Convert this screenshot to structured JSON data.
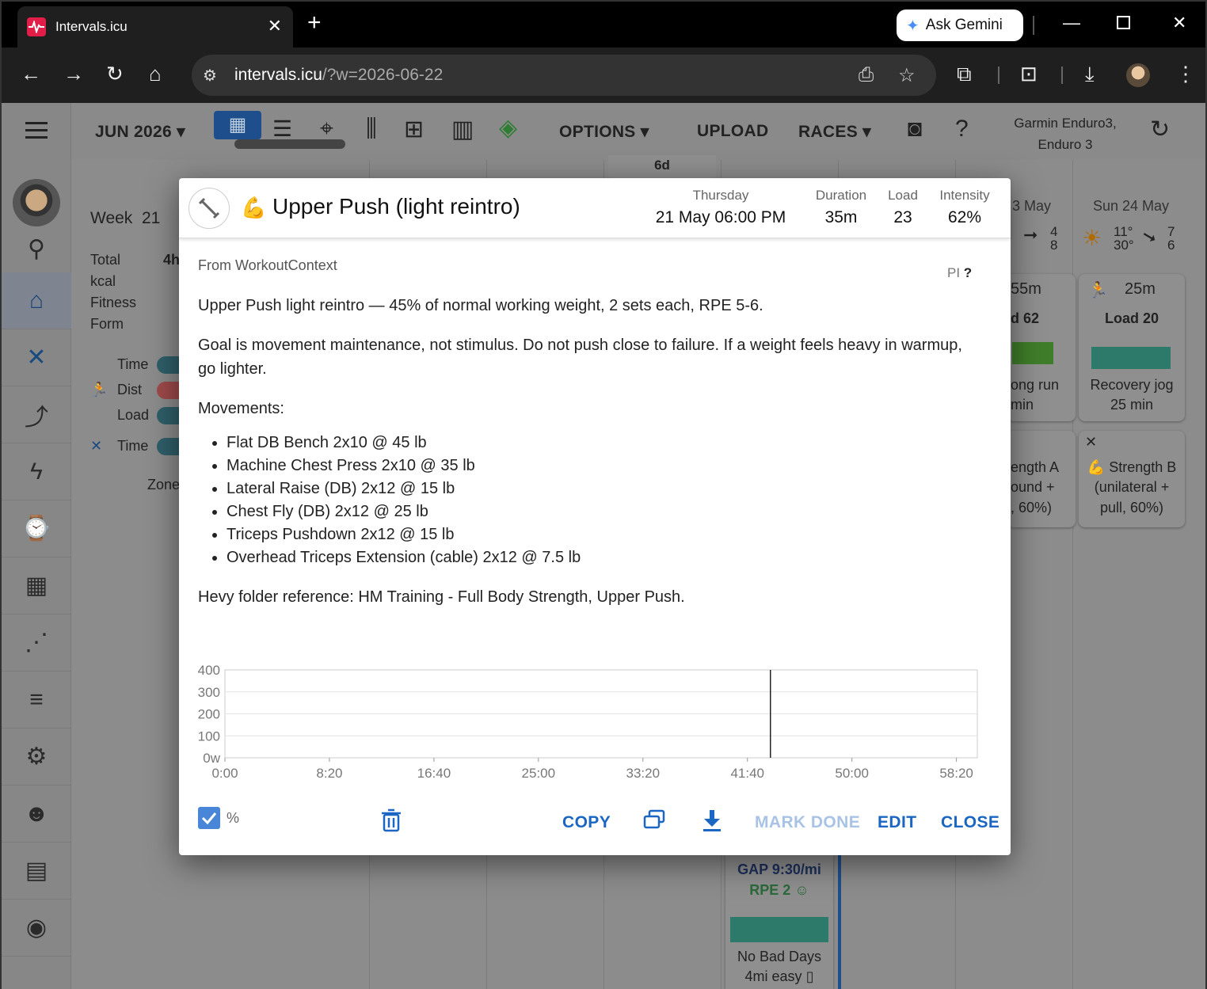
{
  "browser": {
    "tab_title": "Intervals.icu",
    "url_host": "intervals.icu",
    "url_path": "/?w=2026-06-22",
    "gemini_label": "Ask Gemini"
  },
  "topbar": {
    "month": "JUN 2026",
    "options": "OPTIONS",
    "upload": "UPLOAD",
    "races": "RACES",
    "device_line1": "Garmin Enduro3,",
    "device_line2": "Enduro 3",
    "tab_count": "6d"
  },
  "week": {
    "title": "Week",
    "number": "21",
    "total_label": "Total",
    "total_value": "4h",
    "kcal_label": "kcal",
    "fitness_label": "Fitness",
    "form_label": "Form",
    "time_label": "Time",
    "dist_label": "Dist",
    "load_label": "Load",
    "time2_label": "Time",
    "zones_label": "Zone"
  },
  "calendar": {
    "sat_head": "3 May",
    "sun_head": "Sun 24 May",
    "sat_weather_a": "4",
    "sat_weather_b": "8",
    "sun_temp_hi": "11°",
    "sun_temp_lo": "30°",
    "sun_wind_a": "7",
    "sun_wind_b": "6",
    "sat_card_duration": "55m",
    "sat_card_load": "d 62",
    "sat_card_name1": "ong run",
    "sat_card_name2": "min",
    "sun_card_duration": "25m",
    "sun_card_load": "Load 20",
    "sun_card_name1": "Recovery jog",
    "sun_card_name2": "25 min",
    "sat_card2_l1": "ength A",
    "sat_card2_l2": "ound +",
    "sat_card2_l3": ", 60%)",
    "sun_card2_l1": "Strength B",
    "sun_card2_l2": "(unilateral +",
    "sun_card2_l3": "pull, 60%)",
    "bottom_gap": "GAP 9:30/mi",
    "bottom_rpe": "RPE 2",
    "bottom_name1": "No Bad Days",
    "bottom_name2": "4mi easy"
  },
  "modal": {
    "emoji": "💪",
    "title": "Upper Push (light reintro)",
    "day_label": "Thursday",
    "datetime": "21 May 06:00 PM",
    "duration_label": "Duration",
    "duration": "35m",
    "load_label": "Load",
    "load": "23",
    "intensity_label": "Intensity",
    "intensity": "62%",
    "source": "From WorkoutContext",
    "pi_label": "PI",
    "pi_value": "?",
    "para1": "Upper Push light reintro — 45% of normal working weight, 2 sets each, RPE 5-6.",
    "para2": "Goal is movement maintenance, not stimulus. Do not push close to failure. If a weight feels heavy in warmup, go lighter.",
    "movements_heading": "Movements:",
    "movements": [
      "Flat DB Bench 2x10 @ 45 lb",
      "Machine Chest Press 2x10 @ 35 lb",
      "Lateral Raise (DB) 2x12 @ 15 lb",
      "Chest Fly (DB) 2x12 @ 25 lb",
      "Triceps Pushdown 2x12 @ 15 lb",
      "Overhead Triceps Extension (cable) 2x12 @ 7.5 lb"
    ],
    "para3": "Hevy folder reference: HM Training - Full Body Strength, Upper Push.",
    "percent_label": "%",
    "copy": "COPY",
    "mark_done": "MARK DONE",
    "edit": "EDIT",
    "close": "CLOSE"
  },
  "chart_data": {
    "type": "line",
    "y_ticks": [
      "400",
      "300",
      "200",
      "100",
      "0w"
    ],
    "x_ticks": [
      "0:00",
      "8:20",
      "16:40",
      "25:00",
      "33:20",
      "41:40",
      "50:00",
      "58:20"
    ],
    "ylim": [
      0,
      400
    ],
    "xlim_seconds": [
      0,
      3600
    ],
    "marker_x": "43:30",
    "series": []
  }
}
